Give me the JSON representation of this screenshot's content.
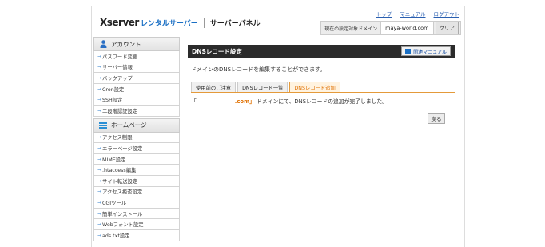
{
  "header": {
    "brand": "Xserver",
    "brand_sub": "レンタルサーバー",
    "panel_title": "サーバーパネル",
    "links": [
      "トップ",
      "マニュアル",
      "ログアウト"
    ],
    "target_label": "現在の設定対象ドメイン",
    "target_value": "maya-world.com",
    "clear_label": "クリア"
  },
  "sidebar": {
    "account": {
      "heading": "アカウント",
      "icon": "user-icon",
      "items": [
        "パスワード変更",
        "サーバー情報",
        "バックアップ",
        "Cron設定",
        "SSH設定",
        "二段階認証設定"
      ]
    },
    "homepage": {
      "heading": "ホームページ",
      "icon": "homepage-icon",
      "items": [
        "アクセス制限",
        "エラーページ設定",
        "MIME設定",
        ".htaccess編集",
        "サイト転送設定",
        "アクセス拒否設定",
        "CGIツール",
        "簡単インストール",
        "Webフォント設定",
        "ads.txt設定"
      ]
    }
  },
  "main": {
    "title": "DNSレコード設定",
    "manual_label": "関連マニュアル",
    "description": "ドメインのDNSレコードを編集することができます。",
    "tabs": [
      "使用前のご注意",
      "DNSレコード一覧",
      "DNSレコード追加"
    ],
    "active_tab": 2,
    "result_open": "「",
    "result_domain": ".com」",
    "result_text": "ドメインにて、DNSレコードの追加が完了しました。",
    "back_label": "戻る"
  },
  "colors": {
    "accent": "#e07000",
    "link": "#2a5fb0",
    "title_bar": "#2b2b2b"
  }
}
